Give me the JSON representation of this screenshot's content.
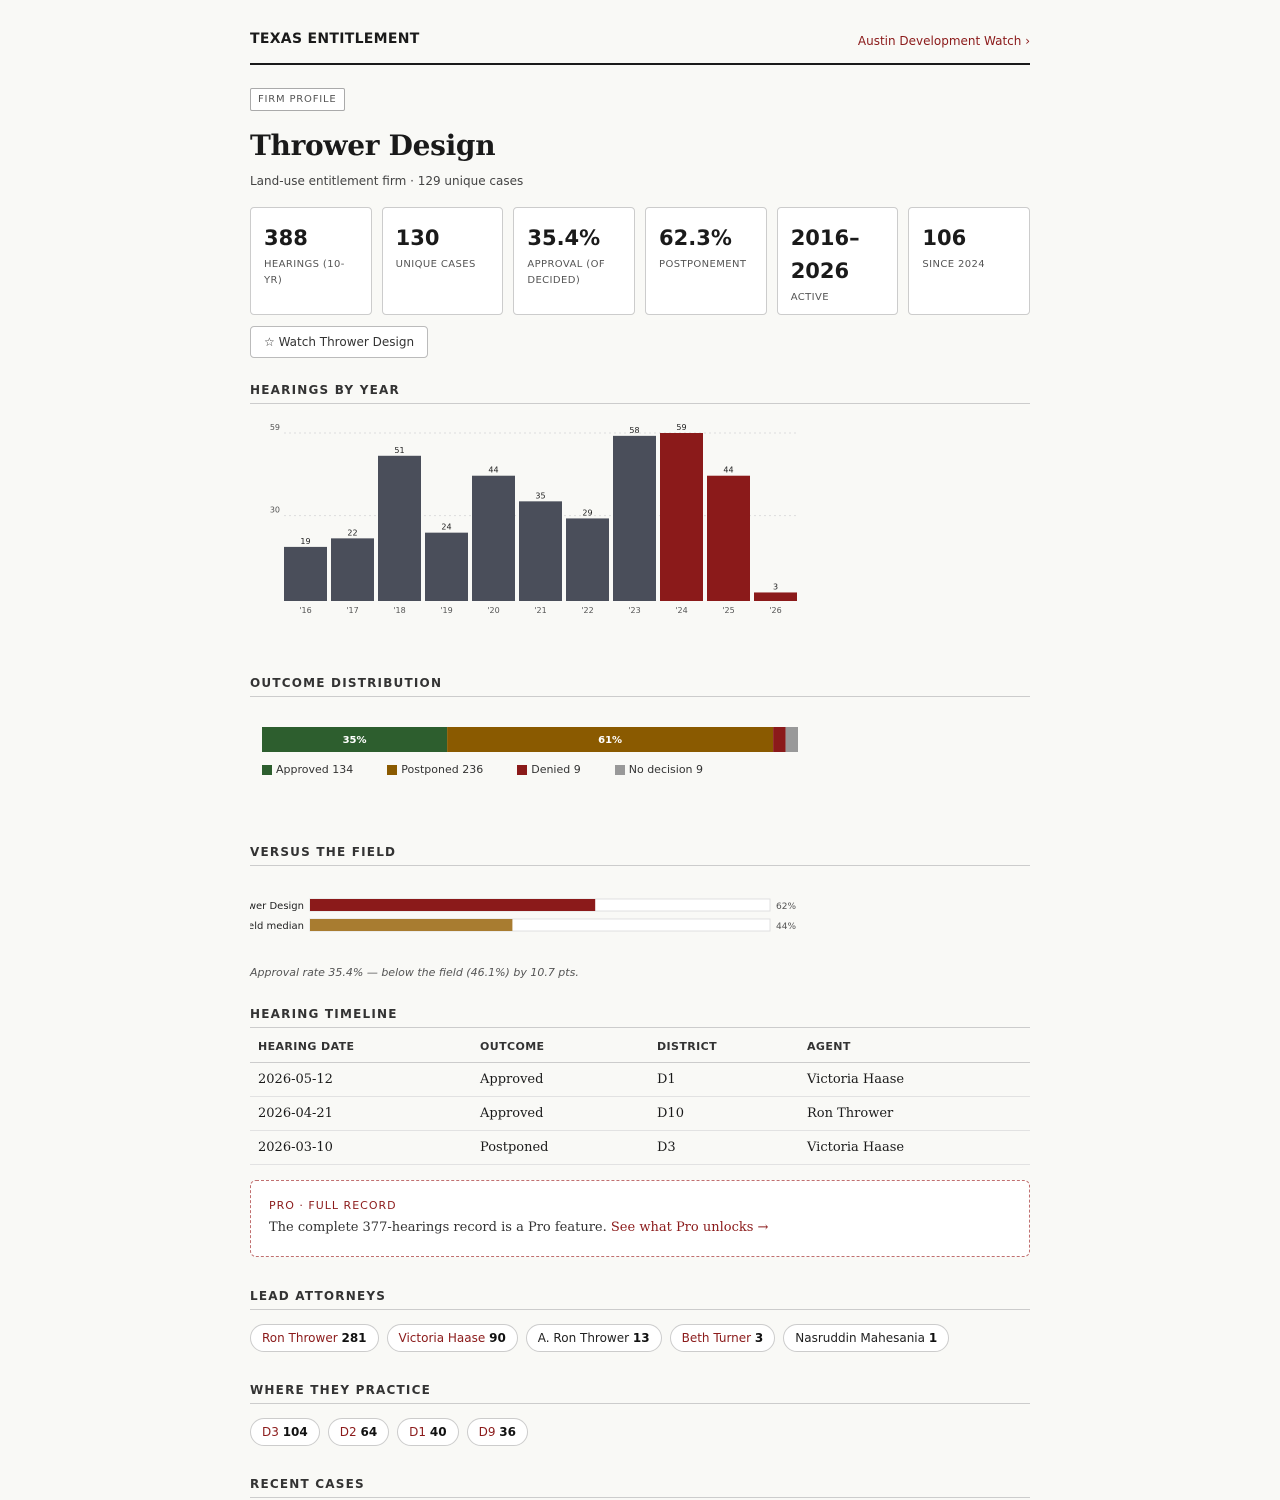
{
  "header": {
    "brand": "TEXAS ENTITLEMENT",
    "link": "Austin Development Watch ›"
  },
  "profile": {
    "tag": "FIRM PROFILE",
    "name": "Thrower Design",
    "subtitle": "Land-use entitlement firm · 129 unique cases",
    "watch_label": "☆ Watch Thrower Design"
  },
  "stats": [
    {
      "value": "388",
      "label": "HEARINGS (10-YR)"
    },
    {
      "value": "130",
      "label": "UNIQUE CASES"
    },
    {
      "value": "35.4%",
      "label": "APPROVAL (OF DECIDED)"
    },
    {
      "value": "62.3%",
      "label": "POSTPONEMENT"
    },
    {
      "value": "2016–2026",
      "label": "ACTIVE"
    },
    {
      "value": "106",
      "label": "SINCE 2024"
    }
  ],
  "sections": {
    "hearings_by_year": "HEARINGS BY YEAR",
    "outcome_distribution": "OUTCOME DISTRIBUTION",
    "versus_field": "VERSUS THE FIELD",
    "hearing_timeline": "HEARING TIMELINE",
    "lead_attorneys": "LEAD ATTORNEYS",
    "where_practice": "WHERE THEY PRACTICE",
    "recent_cases": "RECENT CASES"
  },
  "chart_data": [
    {
      "type": "bar",
      "categories": [
        "'16",
        "'17",
        "'18",
        "'19",
        "'20",
        "'21",
        "'22",
        "'23",
        "'24",
        "'25",
        "'26"
      ],
      "values": [
        19,
        22,
        51,
        24,
        44,
        35,
        29,
        58,
        59,
        44,
        3
      ],
      "highlight_from_index": 8,
      "ylim": [
        0,
        59
      ],
      "yticks": [
        30,
        59
      ],
      "grid": true,
      "colors": {
        "base": "#4a4e5a",
        "highlight": "#8b1a1a"
      }
    },
    {
      "type": "bar",
      "orientation": "horizontal-stacked",
      "series": [
        {
          "name": "Approved",
          "value": 134,
          "color": "#2d5e2e",
          "label": "35%"
        },
        {
          "name": "Postponed",
          "value": 236,
          "color": "#8a5a00",
          "label": "61%"
        },
        {
          "name": "Denied",
          "value": 9,
          "color": "#8b1a1a",
          "label": ""
        },
        {
          "name": "No decision",
          "value": 9,
          "color": "#999999",
          "label": ""
        }
      ]
    },
    {
      "type": "bar",
      "orientation": "horizontal",
      "categories": [
        "Thrower Design",
        "Field median"
      ],
      "values": [
        62,
        44
      ],
      "value_labels": [
        "62%",
        "44%"
      ],
      "xlim": [
        0,
        100
      ],
      "colors": [
        "#8b1a1a",
        "#a87c30"
      ]
    }
  ],
  "versus_note": "Approval rate 35.4% — below the field (46.1%) by 10.7 pts.",
  "timeline": {
    "columns": [
      "HEARING DATE",
      "OUTCOME",
      "DISTRICT",
      "AGENT"
    ],
    "rows": [
      [
        "2026-05-12",
        "Approved",
        "D1",
        "Victoria Haase"
      ],
      [
        "2026-04-21",
        "Approved",
        "D10",
        "Ron Thrower"
      ],
      [
        "2026-03-10",
        "Postponed",
        "D3",
        "Victoria Haase"
      ]
    ]
  },
  "pro": {
    "tag": "PRO · FULL RECORD",
    "text": "The complete 377-hearings record is a Pro feature.",
    "link": "See what Pro unlocks →"
  },
  "attorneys": [
    {
      "name": "Ron Thrower",
      "count": "281"
    },
    {
      "name": "Victoria Haase",
      "count": "90"
    },
    {
      "name": "A. Ron Thrower",
      "count": "13"
    },
    {
      "name": "Beth Turner",
      "count": "3"
    },
    {
      "name": "Nasruddin Mahesania",
      "count": "1"
    }
  ],
  "districts": [
    {
      "name": "D3",
      "count": "104"
    },
    {
      "name": "D2",
      "count": "64"
    },
    {
      "name": "D1",
      "count": "40"
    },
    {
      "name": "D9",
      "count": "36"
    }
  ]
}
